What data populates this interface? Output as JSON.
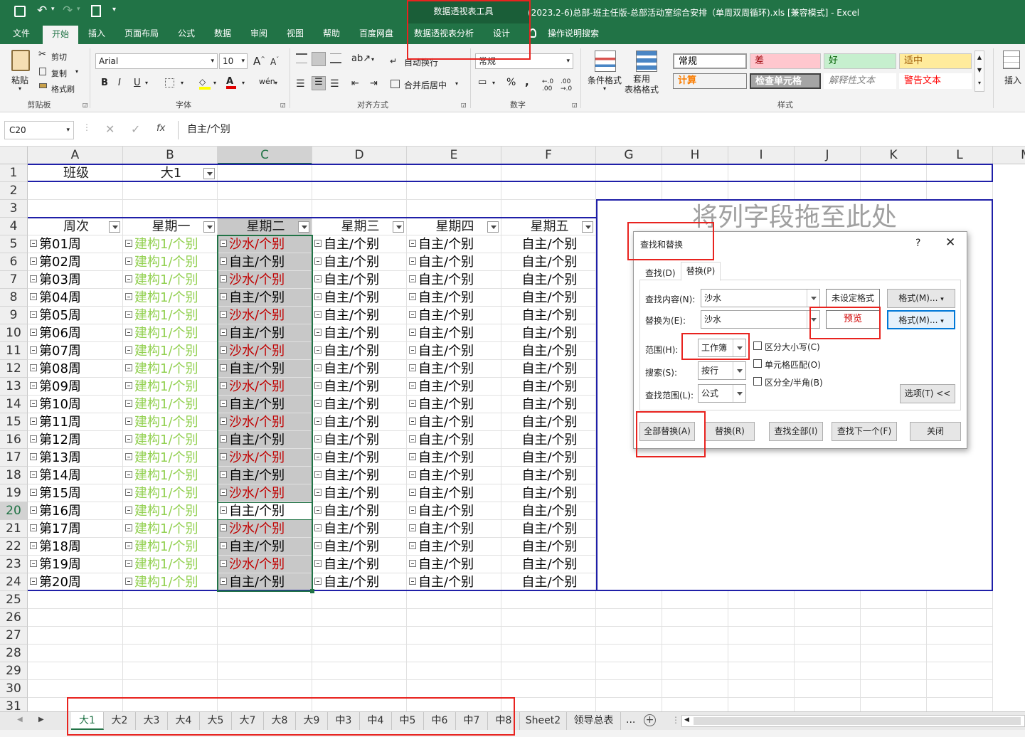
{
  "titlebar": {
    "context_tool": "数据透视表工具",
    "title": "(2023.2-6)总部-班主任版-总部活动室综合安排（单周双周循环).xls  [兼容模式]  -  Excel"
  },
  "ribbon_tabs": [
    "文件",
    "开始",
    "插入",
    "页面布局",
    "公式",
    "数据",
    "审阅",
    "视图",
    "帮助",
    "百度网盘",
    "数据透视表分析",
    "设计",
    "操作说明搜索"
  ],
  "clipboard": {
    "paste": "粘贴",
    "cut": "剪切",
    "copy": "复制",
    "format_painter": "格式刷",
    "group": "剪贴板"
  },
  "font": {
    "name": "Arial",
    "size": "10",
    "bold": "B",
    "italic": "I",
    "underline": "U",
    "group": "字体"
  },
  "alignment": {
    "wrap": "自动换行",
    "merge": "合并后居中",
    "group": "对齐方式"
  },
  "number": {
    "format": "常规",
    "group": "数字"
  },
  "styles_group": {
    "conditional": "条件格式",
    "table": "套用\n表格格式",
    "group": "样式",
    "cells": [
      {
        "label": "常规",
        "bg": "#ffffff",
        "fg": "#000000"
      },
      {
        "label": "差",
        "bg": "#ffc7ce",
        "fg": "#9c0006"
      },
      {
        "label": "好",
        "bg": "#c6efce",
        "fg": "#006100"
      },
      {
        "label": "适中",
        "bg": "#ffeb9c",
        "fg": "#9c5700"
      },
      {
        "label": "计算",
        "bg": "#f2f2f2",
        "fg": "#fa7d00"
      },
      {
        "label": "检查单元格",
        "bg": "#a5a5a5",
        "fg": "#ffffff"
      },
      {
        "label": "解释性文本",
        "bg": "#ffffff",
        "fg": "#7f7f7f"
      },
      {
        "label": "警告文本",
        "bg": "#ffffff",
        "fg": "#ff0000"
      }
    ]
  },
  "insert_label": "插入",
  "formula_bar": {
    "name_box": "C20",
    "fx": "fx",
    "value": "自主/个别"
  },
  "columns": [
    "A",
    "B",
    "C",
    "D",
    "E",
    "F",
    "G",
    "H",
    "I",
    "J",
    "K",
    "L",
    "M"
  ],
  "rows": [
    "1",
    "2",
    "3",
    "4",
    "5",
    "6",
    "7",
    "8",
    "9",
    "10",
    "11",
    "12",
    "13",
    "14",
    "15",
    "16",
    "17",
    "18",
    "19",
    "20",
    "21",
    "22",
    "23",
    "24",
    "25",
    "26",
    "27",
    "28",
    "29",
    "30",
    "31"
  ],
  "pivot": {
    "filter_label": "班级",
    "filter_value": "大1",
    "headers": [
      "周次",
      "星期一",
      "星期二",
      "星期三",
      "星期四",
      "星期五"
    ],
    "drop_zone": "将列字段拖至此处",
    "weeks": [
      "第01周",
      "第02周",
      "第03周",
      "第04周",
      "第05周",
      "第06周",
      "第07周",
      "第08周",
      "第09周",
      "第10周",
      "第11周",
      "第12周",
      "第13周",
      "第14周",
      "第15周",
      "第16周",
      "第17周",
      "第18周",
      "第19周",
      "第20周"
    ],
    "mon": "建构1/个别",
    "tue": [
      "沙水/个别",
      "自主/个别",
      "沙水/个别",
      "自主/个别",
      "沙水/个别",
      "自主/个别",
      "沙水/个别",
      "自主/个别",
      "沙水/个别",
      "自主/个别",
      "沙水/个别",
      "自主/个别",
      "沙水/个别",
      "自主/个别",
      "沙水/个别",
      "自主/个别",
      "沙水/个别",
      "自主/个别",
      "沙水/个别",
      "自主/个别"
    ],
    "other": "自主/个别",
    "colors": {
      "mon": "#92d050",
      "sand": "#c00000",
      "normal": "#000000",
      "sel_bg": "#c8c8c8"
    }
  },
  "dialog": {
    "title": "查找和替换",
    "help": "?",
    "tab_find": "查找(D)",
    "tab_replace": "替换(P)",
    "find_label": "查找内容(N):",
    "find_value": "沙水",
    "replace_label": "替换为(E):",
    "replace_value": "沙水",
    "no_format": "未设定格式",
    "preview": "预览",
    "format_btn": "格式(M)...",
    "scope_label": "范围(H):",
    "scope_value": "工作簿",
    "search_label": "搜索(S):",
    "search_value": "按行",
    "lookin_label": "查找范围(L):",
    "lookin_value": "公式",
    "match_case": "区分大小写(C)",
    "match_cell": "单元格匹配(O)",
    "match_width": "区分全/半角(B)",
    "options": "选项(T) <<",
    "replace_all": "全部替换(A)",
    "replace": "替换(R)",
    "find_all": "查找全部(I)",
    "find_next": "查找下一个(F)",
    "close": "关闭"
  },
  "sheet_tabs": [
    "大1",
    "大2",
    "大3",
    "大4",
    "大5",
    "大7",
    "大8",
    "大9",
    "中3",
    "中4",
    "中5",
    "中6",
    "中7",
    "中8",
    "Sheet2",
    "领导总表"
  ],
  "sheet_more": "...",
  "accent": "#217346"
}
